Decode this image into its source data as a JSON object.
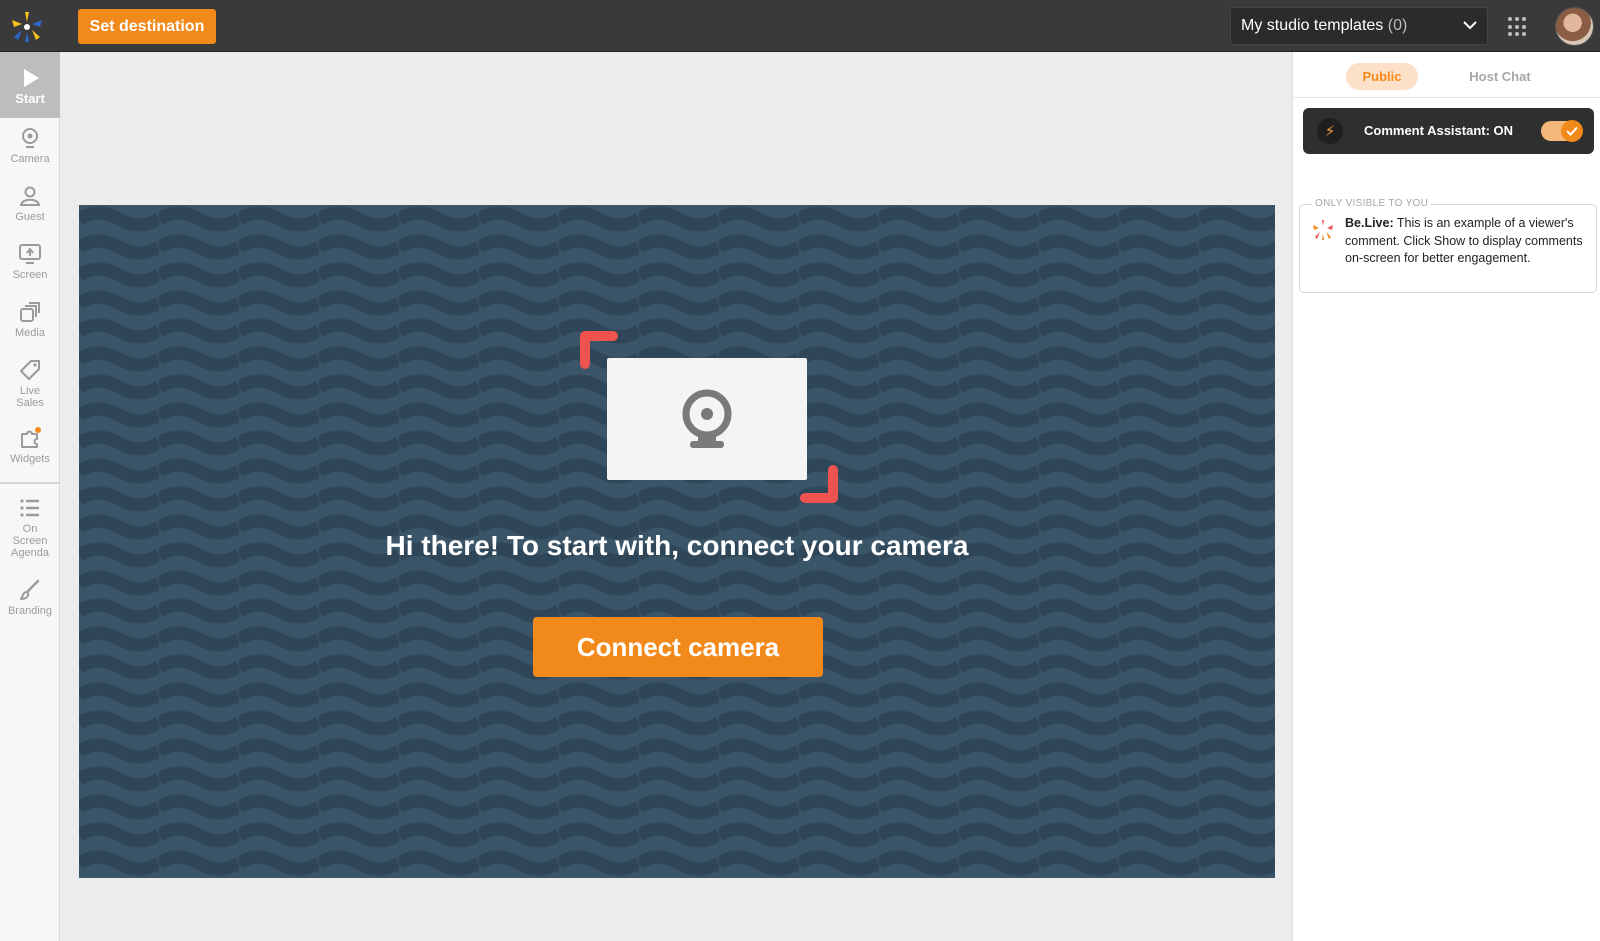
{
  "topbar": {
    "set_destination_label": "Set destination",
    "templates_label": "My studio templates",
    "templates_count": "(0)"
  },
  "sidebar": {
    "items": [
      {
        "label": "Start",
        "icon": "play-icon",
        "active": true
      },
      {
        "label": "Camera",
        "icon": "webcam-icon"
      },
      {
        "label": "Guest",
        "icon": "person-icon"
      },
      {
        "label": "Screen",
        "icon": "screen-share-icon"
      },
      {
        "label": "Media",
        "icon": "media-icon"
      },
      {
        "label": "Live Sales",
        "icon": "price-tag-icon"
      },
      {
        "label": "Widgets",
        "icon": "puzzle-icon"
      },
      {
        "label": "On Screen Agenda",
        "icon": "list-icon"
      },
      {
        "label": "Branding",
        "icon": "brush-icon"
      }
    ]
  },
  "stage": {
    "message": "Hi there! To start with, connect your camera",
    "connect_label": "Connect camera"
  },
  "right_panel": {
    "tabs": [
      {
        "label": "Public",
        "active": true
      },
      {
        "label": "Host Chat",
        "active": false
      }
    ],
    "assistant_label": "Comment Assistant: ON",
    "assistant_on": true,
    "only_visible": "ONLY VISIBLE TO YOU",
    "comment_author": "Be.Live:",
    "comment_text": " This is an example of a viewer's comment. Click Show to display comments on-screen for better engagement."
  },
  "colors": {
    "accent": "#f28a1b",
    "topbar": "#3a3a3a",
    "stage_bg": "#3a5468",
    "corner_marker": "#ef5350"
  }
}
